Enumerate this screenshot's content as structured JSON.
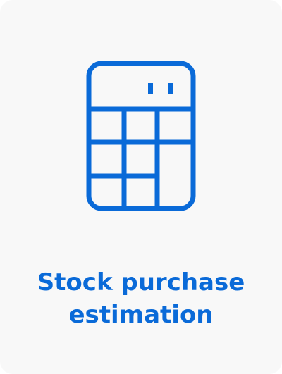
{
  "card": {
    "title_line1": "Stock purchase",
    "title_line2": "estimation",
    "icon": "calculator-icon",
    "accent_color": "#0a6ad8",
    "background_color": "#f8f8f8"
  }
}
